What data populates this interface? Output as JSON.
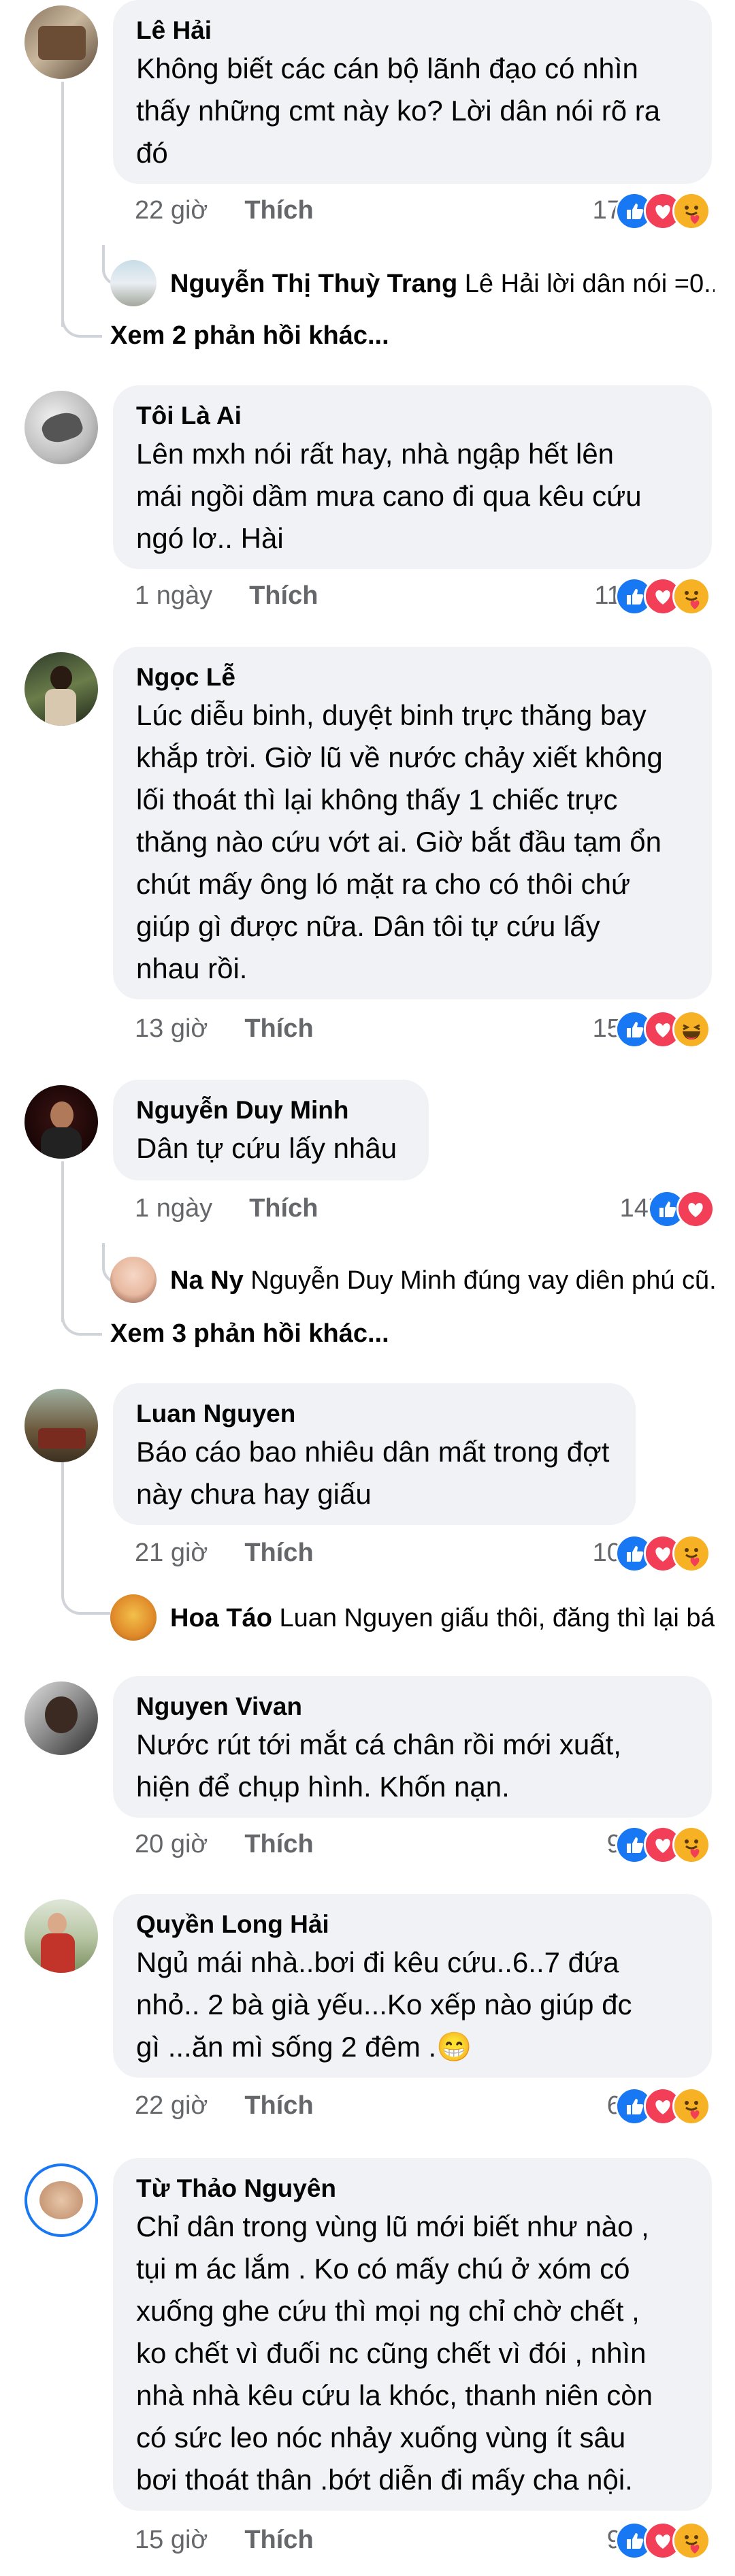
{
  "colors": {
    "like_blue": "#1877f2",
    "love_red": "#f33e58",
    "haha_yellow": "#f7b125",
    "bubble_bg": "#f0f2f5",
    "meta_gray": "#65676b"
  },
  "comments": [
    {
      "author": "Lê Hải",
      "text": "Không biết các cán bộ lãnh đạo có nhìn\nthấy những cmt này ko? Lời dân nói rõ ra\nđó",
      "time": "22 giờ",
      "like": "Thích",
      "count": "174",
      "reactions": [
        "like-icon",
        "love-icon",
        "care-icon"
      ],
      "reply": {
        "author": "Nguyễn Thị Thuỳ Trang",
        "preview": "Lê Hải lời dân nói =0..."
      },
      "more": "Xem 2 phản hồi khác..."
    },
    {
      "author": "Tôi Là Ai",
      "text": "Lên mxh nói rất hay, nhà ngập hết lên\nmái ngồi dầm mưa cano đi qua kêu cứu\nngó lơ.. Hài",
      "time": "1 ngày",
      "like": "Thích",
      "count": "113",
      "reactions": [
        "like-icon",
        "love-icon",
        "care-icon"
      ]
    },
    {
      "author": "Ngọc Lễ",
      "text": "Lúc diễu binh, duyệt binh trực thăng bay\nkhắp trời. Giờ lũ về nước chảy xiết không\nlối thoát thì lại không thấy 1 chiếc trực\nthăng nào cứu vớt ai. Giờ bắt đầu tạm ổn\nchút mấy ông ló mặt ra cho có thôi chứ\ngiúp gì được nữa. Dân tôi tự cứu lấy\nnhau rồi.",
      "time": "13 giờ",
      "like": "Thích",
      "count": "155",
      "reactions": [
        "like-icon",
        "love-icon",
        "haha-icon"
      ]
    },
    {
      "author": "Nguyễn Duy Minh",
      "text": "Dân tự cứu lấy nhâu",
      "time": "1 ngày",
      "like": "Thích",
      "count": "147",
      "reactions": [
        "like-icon",
        "love-icon"
      ],
      "reply": {
        "author": "Na Ny",
        "preview": "Nguyễn Duy Minh đúng vay diên phú cũ..."
      },
      "more": "Xem 3 phản hồi khác..."
    },
    {
      "author": "Luan Nguyen",
      "text": "Báo cáo bao nhiêu dân mất trong đợt\nnày chưa hay giấu",
      "time": "21 giờ",
      "like": "Thích",
      "count": "101",
      "reactions": [
        "like-icon",
        "love-icon",
        "care-icon"
      ],
      "reply": {
        "author": "Hoa Táo",
        "preview": "Luan Nguyen giấu thôi, đăng thì lại bá..."
      }
    },
    {
      "author": "Nguyen Vivan",
      "text": "Nước rút tới mắt cá chân rồi mới xuất,\nhiện để chụp hình. Khốn nạn.",
      "time": "20 giờ",
      "like": "Thích",
      "count": "96",
      "reactions": [
        "like-icon",
        "love-icon",
        "care-icon"
      ]
    },
    {
      "author": "Quyền Long Hải",
      "text": "Ngủ mái nhà..bơi đi kêu cứu..6..7  đứa\nnhỏ.. 2 bà già yếu...Ko xếp nào giúp đc\ngì ...ăn mì sống 2 đêm .😁",
      "time": "22 giờ",
      "like": "Thích",
      "count": "62",
      "reactions": [
        "like-icon",
        "love-icon",
        "care-icon"
      ]
    },
    {
      "author": "Từ Thảo Nguyên",
      "text": "Chỉ dân trong vùng lũ mới biết như nào ,\ntụi m ác lắm . Ko có mấy chú ở xóm có\nxuống ghe cứu thì mọi ng chỉ chờ chết ,\nko chết vì đuối nc cũng chết vì đói , nhìn\nnhà nhà kêu cứu la khóc, thanh niên còn\ncó sức leo nóc nhảy xuống vùng ít sâu\nbơi thoát thân .bớt diễn đi mấy cha nội.",
      "time": "15 giờ",
      "like": "Thích",
      "count": "90",
      "reactions": [
        "like-icon",
        "love-icon",
        "care-icon"
      ]
    }
  ]
}
